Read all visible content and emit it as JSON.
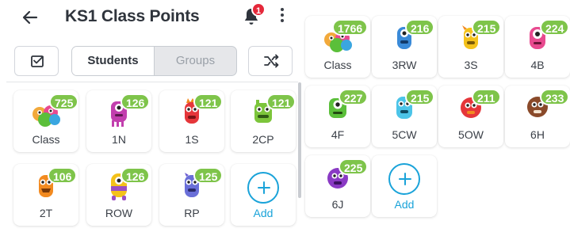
{
  "header": {
    "title": "KS1 Class Points",
    "notification_count": "1"
  },
  "toggle": {
    "students_label": "Students",
    "groups_label": "Groups",
    "selected": "Students"
  },
  "colors": {
    "accent_blue": "#1aa3d9",
    "points_green": "#7ec44a",
    "badge_red": "#e5283a"
  },
  "left_groups": [
    {
      "label": "Class",
      "points": "725",
      "avatar": "monster-group-icon"
    },
    {
      "label": "1N",
      "points": "126",
      "avatar": "pink-monster-icon"
    },
    {
      "label": "1S",
      "points": "121",
      "avatar": "red-monster-icon"
    },
    {
      "label": "2CP",
      "points": "121",
      "avatar": "green-monster-icon"
    },
    {
      "label": "2T",
      "points": "106",
      "avatar": "orange-monster-icon"
    },
    {
      "label": "ROW",
      "points": "126",
      "avatar": "yellow-monster-icon"
    },
    {
      "label": "RP",
      "points": "125",
      "avatar": "blue-monster-icon"
    }
  ],
  "right_groups": [
    {
      "label": "Class",
      "points": "1766",
      "avatar": "monster-group-icon"
    },
    {
      "label": "3RW",
      "points": "216",
      "avatar": "blue-monster-icon"
    },
    {
      "label": "3S",
      "points": "215",
      "avatar": "yellow-monster-icon"
    },
    {
      "label": "4B",
      "points": "224",
      "avatar": "pink-monster-icon"
    },
    {
      "label": "4F",
      "points": "227",
      "avatar": "green-monster-icon"
    },
    {
      "label": "5CW",
      "points": "215",
      "avatar": "cyan-monster-icon"
    },
    {
      "label": "5OW",
      "points": "211",
      "avatar": "red-monster-icon"
    },
    {
      "label": "6H",
      "points": "233",
      "avatar": "brown-monster-icon"
    },
    {
      "label": "6J",
      "points": "225",
      "avatar": "purple-monster-icon"
    }
  ],
  "add_label": "Add"
}
